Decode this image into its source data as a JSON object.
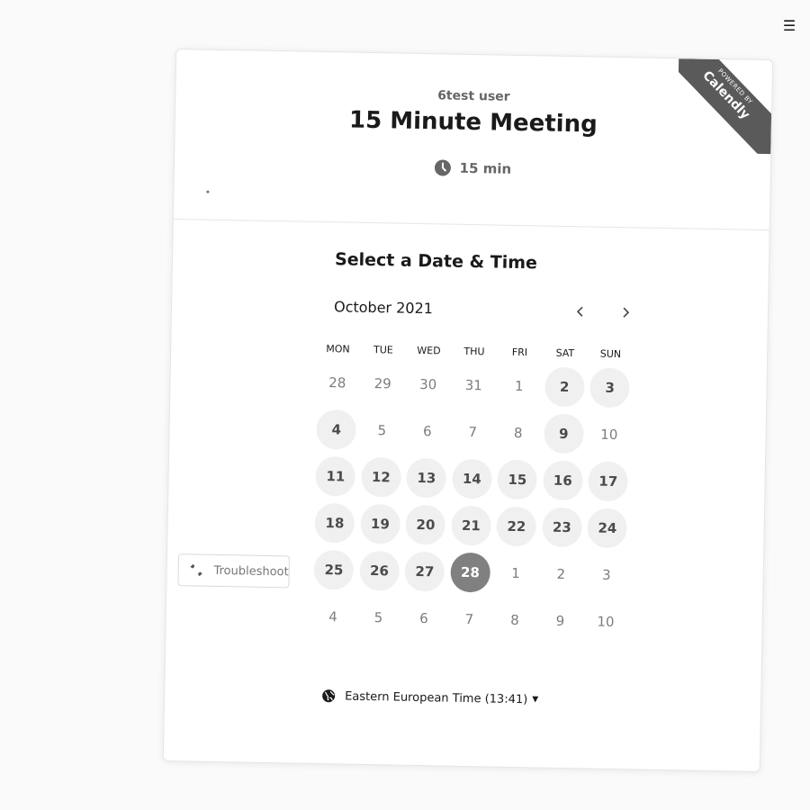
{
  "page": {
    "menu_icon": "hamburger-menu-icon"
  },
  "header": {
    "owner": "6test user",
    "event_title": "15 Minute Meeting",
    "duration": "15 min",
    "duration_icon": "clock-icon",
    "ribbon": {
      "powered": "POWERED BY",
      "brand": "Calendly"
    }
  },
  "scheduler": {
    "section_title": "Select a Date & Time",
    "month_label": "October 2021",
    "prev_icon": "chevron-left-icon",
    "next_icon": "chevron-right-icon",
    "weekdays": [
      "MON",
      "TUE",
      "WED",
      "THU",
      "FRI",
      "SAT",
      "SUN"
    ],
    "weeks": [
      [
        {
          "day": "28",
          "state": "outside"
        },
        {
          "day": "29",
          "state": "outside"
        },
        {
          "day": "30",
          "state": "outside"
        },
        {
          "day": "31",
          "state": "outside"
        },
        {
          "day": "1",
          "state": "unavailable"
        },
        {
          "day": "2",
          "state": "available"
        },
        {
          "day": "3",
          "state": "available"
        }
      ],
      [
        {
          "day": "4",
          "state": "available"
        },
        {
          "day": "5",
          "state": "unavailable"
        },
        {
          "day": "6",
          "state": "unavailable"
        },
        {
          "day": "7",
          "state": "unavailable"
        },
        {
          "day": "8",
          "state": "unavailable"
        },
        {
          "day": "9",
          "state": "available"
        },
        {
          "day": "10",
          "state": "unavailable"
        }
      ],
      [
        {
          "day": "11",
          "state": "available"
        },
        {
          "day": "12",
          "state": "available"
        },
        {
          "day": "13",
          "state": "available"
        },
        {
          "day": "14",
          "state": "available"
        },
        {
          "day": "15",
          "state": "available"
        },
        {
          "day": "16",
          "state": "available"
        },
        {
          "day": "17",
          "state": "available"
        }
      ],
      [
        {
          "day": "18",
          "state": "available"
        },
        {
          "day": "19",
          "state": "available"
        },
        {
          "day": "20",
          "state": "available"
        },
        {
          "day": "21",
          "state": "available"
        },
        {
          "day": "22",
          "state": "available"
        },
        {
          "day": "23",
          "state": "available"
        },
        {
          "day": "24",
          "state": "available"
        }
      ],
      [
        {
          "day": "25",
          "state": "available"
        },
        {
          "day": "26",
          "state": "available"
        },
        {
          "day": "27",
          "state": "available"
        },
        {
          "day": "28",
          "state": "selected"
        },
        {
          "day": "1",
          "state": "outside"
        },
        {
          "day": "2",
          "state": "outside"
        },
        {
          "day": "3",
          "state": "outside"
        }
      ],
      [
        {
          "day": "4",
          "state": "outside"
        },
        {
          "day": "5",
          "state": "outside"
        },
        {
          "day": "6",
          "state": "outside"
        },
        {
          "day": "7",
          "state": "outside"
        },
        {
          "day": "8",
          "state": "outside"
        },
        {
          "day": "9",
          "state": "outside"
        },
        {
          "day": "10",
          "state": "outside"
        }
      ]
    ],
    "timezone": "Eastern European Time (13:41)",
    "timezone_icon": "globe-icon"
  },
  "footer": {
    "troubleshoot_label": "Troubleshoot",
    "troubleshoot_icon": "wrench-icon"
  },
  "colors": {
    "ribbon": "#5a5a5a",
    "selected_day": "#808080",
    "available_day_bg": "#f0f0f0",
    "text_muted": "#7d7d7d"
  }
}
